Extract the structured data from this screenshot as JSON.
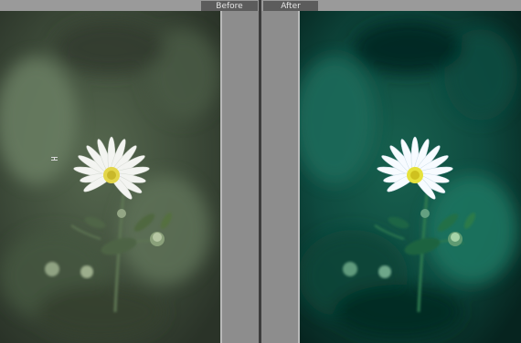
{
  "compare": {
    "before_label": "Before",
    "after_label": "After"
  },
  "colors": {
    "ui_gray": "#8c8c8c",
    "tab_bg": "#5c5c5c",
    "divider": "#3c3c3c",
    "before_tone": "#4b5e44",
    "after_tone": "#0f4e45"
  },
  "icons": {
    "cursor": "i-beam-cursor"
  }
}
